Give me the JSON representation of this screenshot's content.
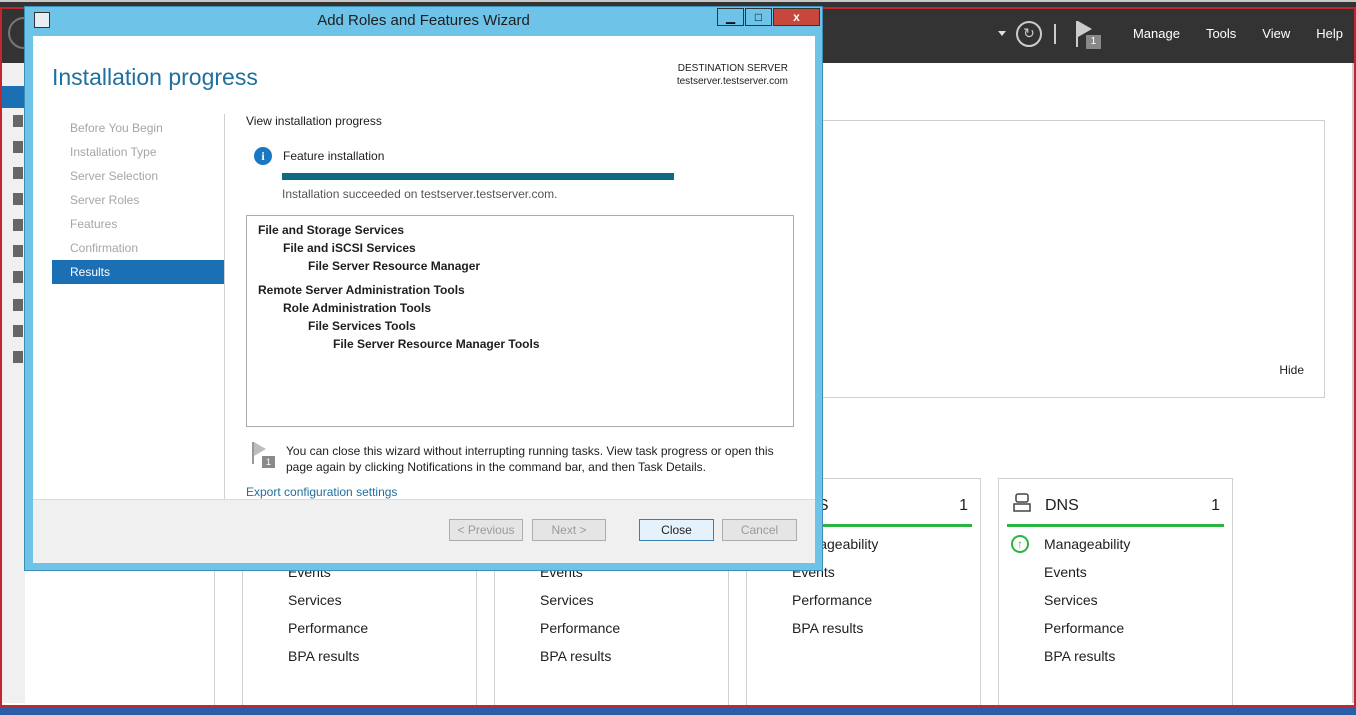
{
  "server_manager": {
    "menu": [
      "Manage",
      "Tools",
      "View",
      "Help"
    ],
    "notification_count": "1",
    "hide_label": "Hide",
    "tiles": [
      {
        "name": "RMS",
        "count": "1",
        "rows": [
          "Manageability",
          "Events",
          "Performance",
          "BPA results"
        ]
      },
      {
        "name": "DNS",
        "count": "1",
        "rows": [
          "Manageability",
          "Events",
          "Services",
          "Performance",
          "BPA results"
        ]
      }
    ],
    "tile_rows_partial": [
      "Events",
      "Services",
      "Performance",
      "BPA results"
    ]
  },
  "wizard": {
    "title": "Add Roles and Features Wizard",
    "controls": {
      "minimize": "▁",
      "maximize": "□",
      "close": "x"
    },
    "heading": "Installation progress",
    "destination_label": "DESTINATION SERVER",
    "destination_server": "testserver.testserver.com",
    "steps": [
      "Before You Begin",
      "Installation Type",
      "Server Selection",
      "Server Roles",
      "Features",
      "Confirmation",
      "Results"
    ],
    "active_step": "Results",
    "view_label": "View installation progress",
    "feature_label": "Feature installation",
    "progress": 1.0,
    "success_text": "Installation succeeded on testserver.testserver.com.",
    "results": [
      {
        "text": "File and Storage Services",
        "level": 0
      },
      {
        "text": "File and iSCSI Services",
        "level": 1
      },
      {
        "text": "File Server Resource Manager",
        "level": 2
      },
      {
        "text": "Remote Server Administration Tools",
        "level": 0
      },
      {
        "text": "Role Administration Tools",
        "level": 1
      },
      {
        "text": "File Services Tools",
        "level": 2
      },
      {
        "text": "File Server Resource Manager Tools",
        "level": 3
      }
    ],
    "note_badge": "1",
    "note_text": "You can close this wizard without interrupting running tasks. View task progress or open this page again by clicking Notifications in the command bar, and then Task Details.",
    "export_link": "Export configuration settings",
    "buttons": {
      "previous": "< Previous",
      "next": "Next >",
      "close": "Close",
      "cancel": "Cancel"
    }
  }
}
